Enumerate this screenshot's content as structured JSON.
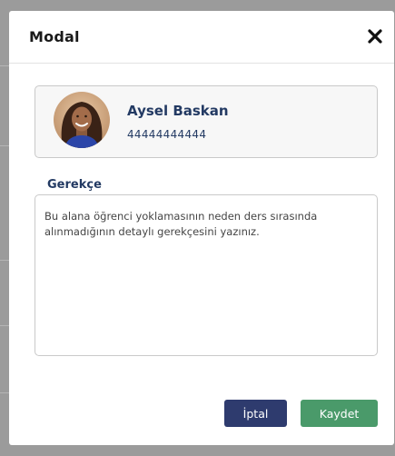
{
  "modal": {
    "title": "Modal",
    "close_icon": "close-icon"
  },
  "student": {
    "name": "Aysel Baskan",
    "id_number": "44444444444",
    "avatar_icon": "student-avatar"
  },
  "reason": {
    "label": "Gerekçe",
    "placeholder": "Bu alana öğrenci yoklamasının neden ders sırasında alınmadığının detaylı gerekçesini yazınız.",
    "value": ""
  },
  "actions": {
    "cancel_label": "İptal",
    "save_label": "Kaydet"
  },
  "colors": {
    "backdrop": "#9b9b9b",
    "primary_text": "#233a63",
    "cancel_button": "#2e3b6e",
    "save_button": "#4a9a6a"
  }
}
